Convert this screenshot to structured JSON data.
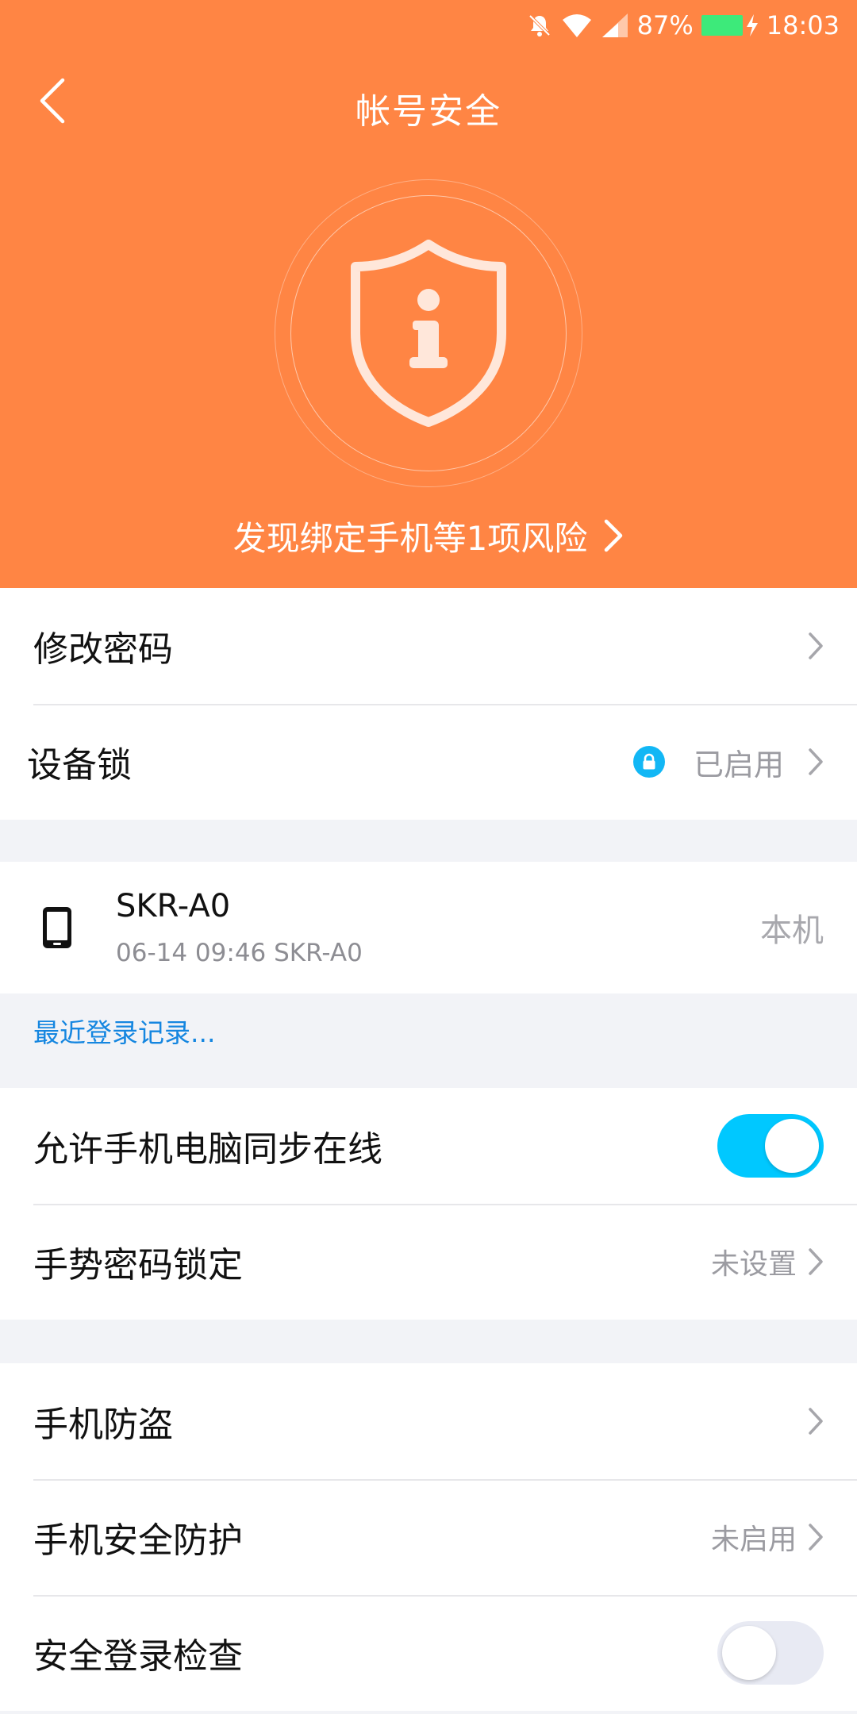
{
  "status_bar": {
    "battery": "87%",
    "time": "18:03",
    "icons": [
      "bell-muted-icon",
      "wifi-icon",
      "signal-icon",
      "battery-charging-icon"
    ]
  },
  "header": {
    "title": "帐号安全",
    "risk_text": "发现绑定手机等1项风险",
    "background_color": "#ff8544"
  },
  "security_list": {
    "change_password": {
      "label": "修改密码"
    },
    "device_lock": {
      "label": "设备锁",
      "status": "已启用"
    }
  },
  "device": {
    "name": "SKR-A0",
    "detail": "06-14 09:46 SKR-A0",
    "tag": "本机"
  },
  "recent_login": {
    "label": "最近登录记录..."
  },
  "settings": {
    "sync_online": {
      "label": "允许手机电脑同步在线",
      "enabled": true
    },
    "gesture_lock": {
      "label": "手势密码锁定",
      "status": "未设置"
    }
  },
  "protection": {
    "anti_theft": {
      "label": "手机防盗"
    },
    "security_protect": {
      "label": "手机安全防护",
      "status": "未启用"
    },
    "login_check": {
      "label": "安全登录检查",
      "enabled": false
    }
  },
  "colors": {
    "accent_blue": "#12b7f5",
    "toggle_on": "#00c8ff",
    "link": "#1586e0"
  }
}
